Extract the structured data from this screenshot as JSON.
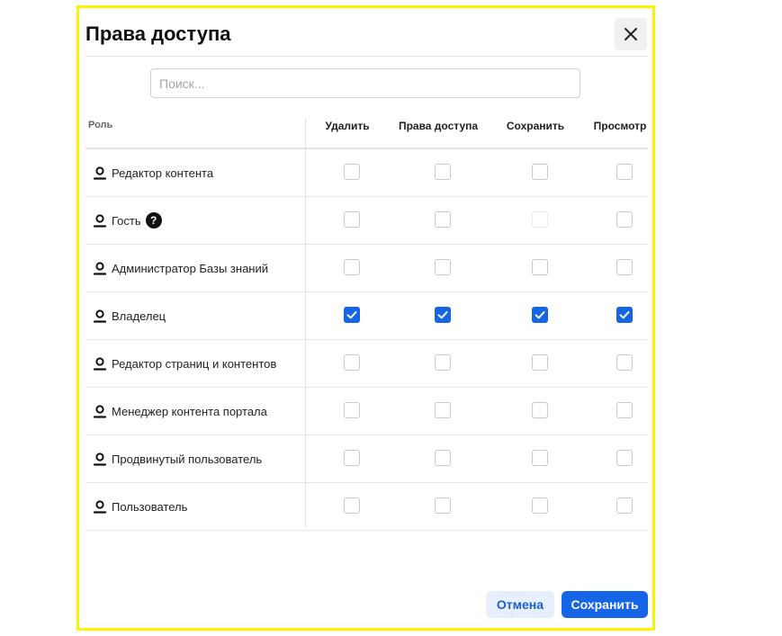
{
  "dialog": {
    "title": "Права доступа",
    "close_icon": "close-icon",
    "accent_color": "#1565e6",
    "frame_color": "#fff200"
  },
  "search": {
    "placeholder": "Поиск...",
    "value": ""
  },
  "table": {
    "columns": [
      "Роль",
      "Удалить",
      "Права доступа",
      "Сохранить",
      "Просмотр"
    ],
    "rows": [
      {
        "role": "Редактор контента",
        "icon": "user-icon",
        "has_help": false,
        "checks": [
          false,
          false,
          false,
          false
        ],
        "disabled": [
          false,
          false,
          false,
          false
        ]
      },
      {
        "role": "Гость",
        "icon": "user-icon",
        "has_help": true,
        "help_label": "?",
        "checks": [
          false,
          false,
          false,
          false
        ],
        "disabled": [
          false,
          false,
          true,
          false
        ]
      },
      {
        "role": "Администратор Базы знаний",
        "icon": "user-icon",
        "has_help": false,
        "checks": [
          false,
          false,
          false,
          false
        ],
        "disabled": [
          false,
          false,
          false,
          false
        ]
      },
      {
        "role": "Владелец",
        "icon": "user-icon",
        "has_help": false,
        "checks": [
          true,
          true,
          true,
          true
        ],
        "disabled": [
          false,
          false,
          false,
          false
        ]
      },
      {
        "role": "Редактор страниц и контентов",
        "icon": "user-icon",
        "has_help": false,
        "checks": [
          false,
          false,
          false,
          false
        ],
        "disabled": [
          false,
          false,
          false,
          false
        ]
      },
      {
        "role": "Менеджер контента портала",
        "icon": "user-icon",
        "has_help": false,
        "checks": [
          false,
          false,
          false,
          false
        ],
        "disabled": [
          false,
          false,
          false,
          false
        ]
      },
      {
        "role": "Продвинутый пользователь",
        "icon": "user-icon",
        "has_help": false,
        "checks": [
          false,
          false,
          false,
          false
        ],
        "disabled": [
          false,
          false,
          false,
          false
        ]
      },
      {
        "role": "Пользователь",
        "icon": "user-icon",
        "has_help": false,
        "checks": [
          false,
          false,
          false,
          false
        ],
        "disabled": [
          false,
          false,
          false,
          false
        ]
      }
    ]
  },
  "footer": {
    "cancel_label": "Отмена",
    "save_label": "Сохранить"
  }
}
